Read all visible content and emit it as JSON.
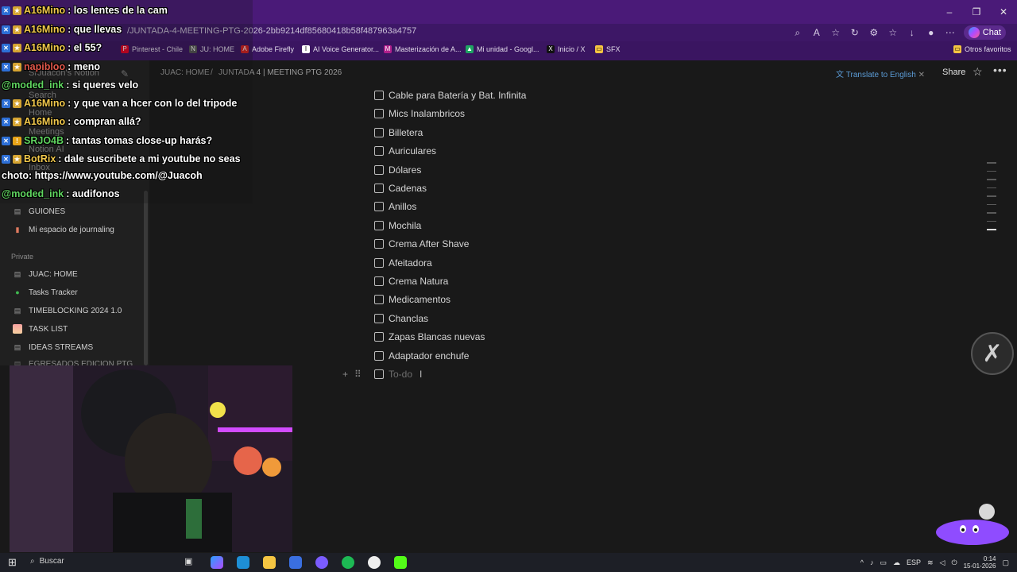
{
  "browser": {
    "url": "/JUNTADA-4-MEETING-PTG-2026-2bb9214df85680418b58f487963a4757",
    "chat_label": "Chat",
    "window_controls": [
      "–",
      "❐",
      "✕"
    ],
    "bookmarks": [
      {
        "label": "Pinterest - Chile",
        "color": "#e60023",
        "glyph": "P"
      },
      {
        "label": "JU: HOME",
        "color": "#555555",
        "glyph": "N"
      },
      {
        "label": "Adobe Firefly",
        "color": "#d4201f",
        "glyph": "A"
      },
      {
        "label": "AI Voice Generator...",
        "color": "#ffffff",
        "glyph": "I"
      },
      {
        "label": "Masterización de A...",
        "color": "#b0208c",
        "glyph": "M"
      },
      {
        "label": "Mi unidad - Googl...",
        "color": "#1fa463",
        "glyph": "▲"
      },
      {
        "label": "Inicio / X",
        "color": "#111111",
        "glyph": "X"
      },
      {
        "label": "SFX",
        "color": "#f5c542",
        "glyph": "▭"
      }
    ],
    "other_favorites": "Otros favoritos"
  },
  "sidebar": {
    "workspace": "SrJuacoh's Notion",
    "top_items": [
      "Search",
      "Home",
      "Meetings",
      "Notion AI",
      "Inbox"
    ],
    "shared_items": [
      {
        "label": "GUIONES",
        "icon": "page-icon"
      },
      {
        "label": "Mi espacio de journaling",
        "icon": "notebook-icon"
      }
    ],
    "private_label": "Private",
    "private_items": [
      {
        "label": "JUAC: HOME",
        "icon": "page-icon"
      },
      {
        "label": "Tasks Tracker",
        "icon": "check-circle-icon"
      },
      {
        "label": "TIMEBLOCKING 2024 1.0",
        "icon": "page-icon"
      },
      {
        "label": "TASK LIST",
        "icon": "gradient-icon"
      },
      {
        "label": "IDEAS STREAMS",
        "icon": "page-icon"
      },
      {
        "label": "EGRESADOS EDICION PTG",
        "icon": "page-icon"
      }
    ]
  },
  "header": {
    "breadcrumb_1": "JUAC: HOME",
    "breadcrumb_sep": "/",
    "breadcrumb_2": "JUNTADA 4 | MEETING PTG 2026",
    "translate": "Translate to English",
    "share": "Share"
  },
  "todos": [
    "Cable para Batería y Bat. Infinita",
    "Mics Inalambricos",
    "Billetera",
    "Auriculares",
    "Dólares",
    "Cadenas",
    "Anillos",
    "Mochila",
    "Crema After Shave",
    "Afeitadora",
    "Crema Natura",
    "Medicamentos",
    "Chanclas",
    "Zapas Blancas nuevas",
    "Adaptador enchufe"
  ],
  "todo_placeholder": "To-do",
  "chat": [
    {
      "user": "A16Mino",
      "msg": ": los lentes de la cam",
      "color": "yellow"
    },
    {
      "user": "A16Mino",
      "msg": ": que llevas",
      "color": "yellow"
    },
    {
      "user": "A16Mino",
      "msg": ": el 55?",
      "color": "yellow"
    },
    {
      "user": "napibloo",
      "msg": ": meno",
      "color": "red"
    },
    {
      "user": "@moded_ink",
      "msg": ": si queres velo",
      "color": "green"
    },
    {
      "user": "A16Mino",
      "msg": ": y que van a hcer con lo del tripode",
      "color": "yellow"
    },
    {
      "user": "A16Mino",
      "msg": ": compran allá?",
      "color": "yellow"
    },
    {
      "user": "SRJO4B",
      "msg": ": tantas tomas close-up harás?",
      "color": "green"
    },
    {
      "user": "BotRix",
      "msg": ": dale suscribete a mi youtube no seas",
      "color": "yellow"
    },
    {
      "user": "",
      "msg": "choto: https://www.youtube.com/@Juacoh",
      "color": "none"
    },
    {
      "user": "@moded_ink",
      "msg": ": audifonos",
      "color": "green"
    }
  ],
  "taskbar": {
    "search": "Buscar",
    "lang": "ESP",
    "time": "0:14",
    "date": "15-01-2026"
  }
}
